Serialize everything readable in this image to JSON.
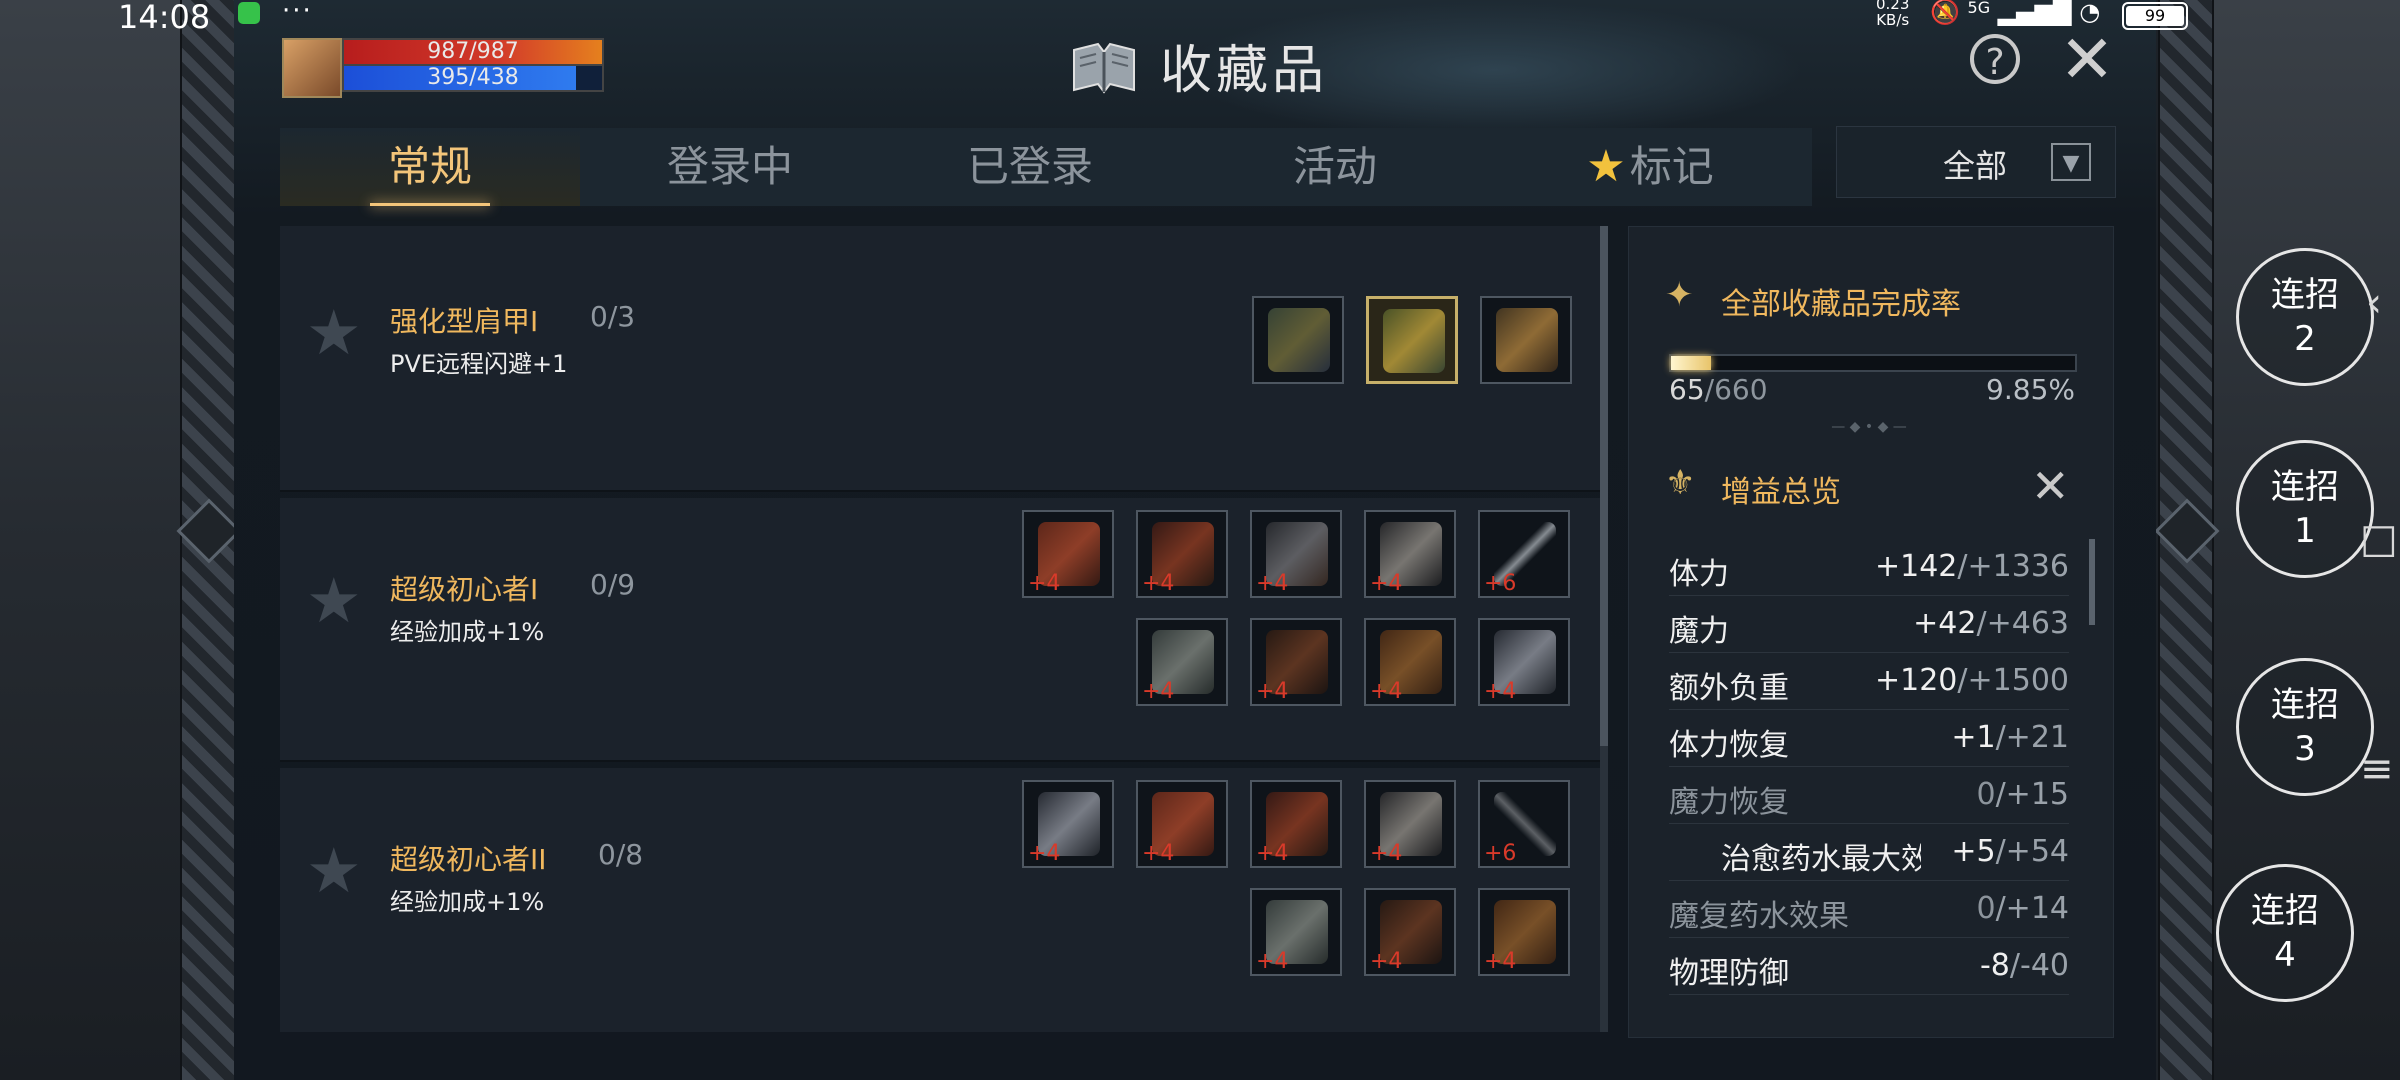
{
  "status_bar": {
    "time": "14:08",
    "dots": "···",
    "speed_value": "0.23",
    "speed_unit": "KB/s",
    "network": "5G",
    "battery": "99"
  },
  "player": {
    "hp": "987/987",
    "mp": "395/438",
    "hp_fraction": 1.0,
    "mp_fraction": 0.9
  },
  "header": {
    "title": "收藏品",
    "help": "?",
    "close": "✕"
  },
  "tabs": [
    {
      "label": "常规",
      "active": true
    },
    {
      "label": "登录中",
      "active": false
    },
    {
      "label": "已登录",
      "active": false
    },
    {
      "label": "活动",
      "active": false
    },
    {
      "label": "标记",
      "active": false,
      "icon": "star-icon"
    }
  ],
  "filter": {
    "selected": "全部",
    "arrow": "▼"
  },
  "collections": [
    {
      "name": "强化型肩甲I",
      "progress": "0/3",
      "bonus": "PVE远程闪避+1",
      "items": [
        {
          "icon": "shoulder-armor-icon",
          "level": ""
        },
        {
          "icon": "shoulder-armor-icon",
          "level": "",
          "selected": true
        },
        {
          "icon": "shoulder-armor-icon",
          "level": ""
        }
      ]
    },
    {
      "name": "超级初心者I",
      "progress": "0/9",
      "bonus": "经验加成+1%",
      "items": [
        {
          "icon": "gloves-icon",
          "level": "+4"
        },
        {
          "icon": "cloak-icon",
          "level": "+4"
        },
        {
          "icon": "helmet-icon",
          "level": "+4"
        },
        {
          "icon": "horned-helmet-icon",
          "level": "+4"
        },
        {
          "icon": "sword-icon",
          "level": "+6"
        },
        {
          "icon": "chainmail-icon",
          "level": "+4"
        },
        {
          "icon": "boots-icon",
          "level": "+4"
        },
        {
          "icon": "leather-pants-icon",
          "level": "+4"
        },
        {
          "icon": "jacket-icon",
          "level": "+4"
        }
      ]
    },
    {
      "name": "超级初心者II",
      "progress": "0/8",
      "bonus": "经验加成+1%",
      "items": [
        {
          "icon": "jacket-icon",
          "level": "+4"
        },
        {
          "icon": "gloves-icon",
          "level": "+4"
        },
        {
          "icon": "cloak-icon",
          "level": "+4"
        },
        {
          "icon": "horned-helmet-icon",
          "level": "+4"
        },
        {
          "icon": "bow-icon",
          "level": "+6"
        },
        {
          "icon": "chainmail-icon",
          "level": "+4"
        },
        {
          "icon": "boots-icon",
          "level": "+4"
        },
        {
          "icon": "leather-pants-icon",
          "level": "+4"
        }
      ]
    }
  ],
  "completion": {
    "title": "全部收藏品完成率",
    "current": "65",
    "total": "/660",
    "percent": "9.85%",
    "fraction": 0.0985
  },
  "buffs": {
    "title": "增益总览",
    "close": "✕",
    "stats": [
      {
        "name": "体力",
        "value": "+142",
        "max": "/+1336",
        "dim": false
      },
      {
        "name": "魔力",
        "value": "+42",
        "max": "/+463",
        "dim": false
      },
      {
        "name": "额外负重",
        "value": "+120",
        "max": "/+1500",
        "dim": false
      },
      {
        "name": "体力恢复",
        "value": "+1",
        "max": "/+21",
        "dim": false
      },
      {
        "name": "魔力恢复",
        "value": "0",
        "max": "/+15",
        "dim": true
      },
      {
        "name": "治愈药水最大效",
        "value": "+5",
        "max": "/+54",
        "dim": false,
        "indent": true
      },
      {
        "name": "魔复药水效果",
        "value": "0",
        "max": "/+14",
        "dim": true
      },
      {
        "name": "物理防御",
        "value": "-8",
        "max": "/-40",
        "dim": false
      }
    ]
  },
  "combos": [
    {
      "label": "连招",
      "num": "2"
    },
    {
      "label": "连招",
      "num": "1"
    },
    {
      "label": "连招",
      "num": "3"
    },
    {
      "label": "连招",
      "num": "4"
    }
  ],
  "colors": {
    "gold": "#f0b85e",
    "tab_active": "#f3c57a",
    "item_level": "#d93a2a",
    "star": "#f2c23d"
  }
}
